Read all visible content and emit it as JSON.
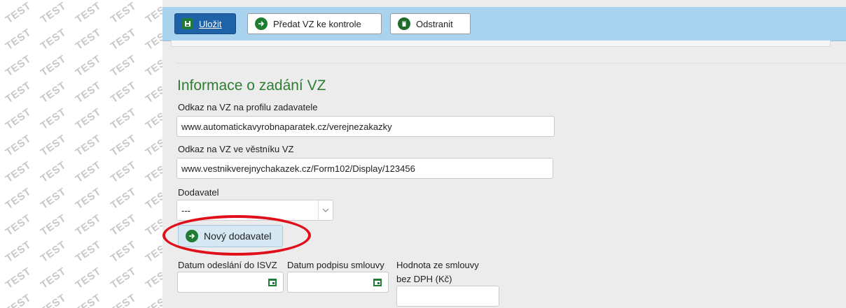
{
  "watermark": {
    "text": "TEST"
  },
  "toolbar": {
    "save_label": "Uložit",
    "submit_label": "Předat VZ ke kontrole",
    "delete_label": "Odstranit",
    "save_icon": "floppy-disk-icon",
    "submit_icon": "arrow-right-circle-icon",
    "delete_icon": "trash-icon"
  },
  "section": {
    "title": "Informace o zadání VZ",
    "title_color": "#2e7d32"
  },
  "form": {
    "profile_link": {
      "label": "Odkaz na VZ na profilu zadavatele",
      "value": "www.automatickavyrobnaparatek.cz/verejnezakazky"
    },
    "journal_link": {
      "label": "Odkaz na VZ ve věstníku VZ",
      "value": "www.vestnikverejnychakazek.cz/Form102/Display/123456"
    },
    "supplier": {
      "label": "Dodavatel",
      "selected": "---"
    },
    "new_supplier_button": "Nový dodavatel",
    "date_sent": {
      "label": "Datum odeslání do ISVZ",
      "value": ""
    },
    "date_signed": {
      "label": "Datum podpisu smlouvy",
      "value": ""
    },
    "contract_value": {
      "label_line1": "Hodnota ze smlouvy",
      "label_line2": "bez DPH (Kč)",
      "value": ""
    }
  },
  "colors": {
    "toolbar_bg": "#a9d3ee",
    "primary_button": "#1f62a8",
    "icon_green": "#1e7d32",
    "highlight_red": "#e0101a"
  }
}
